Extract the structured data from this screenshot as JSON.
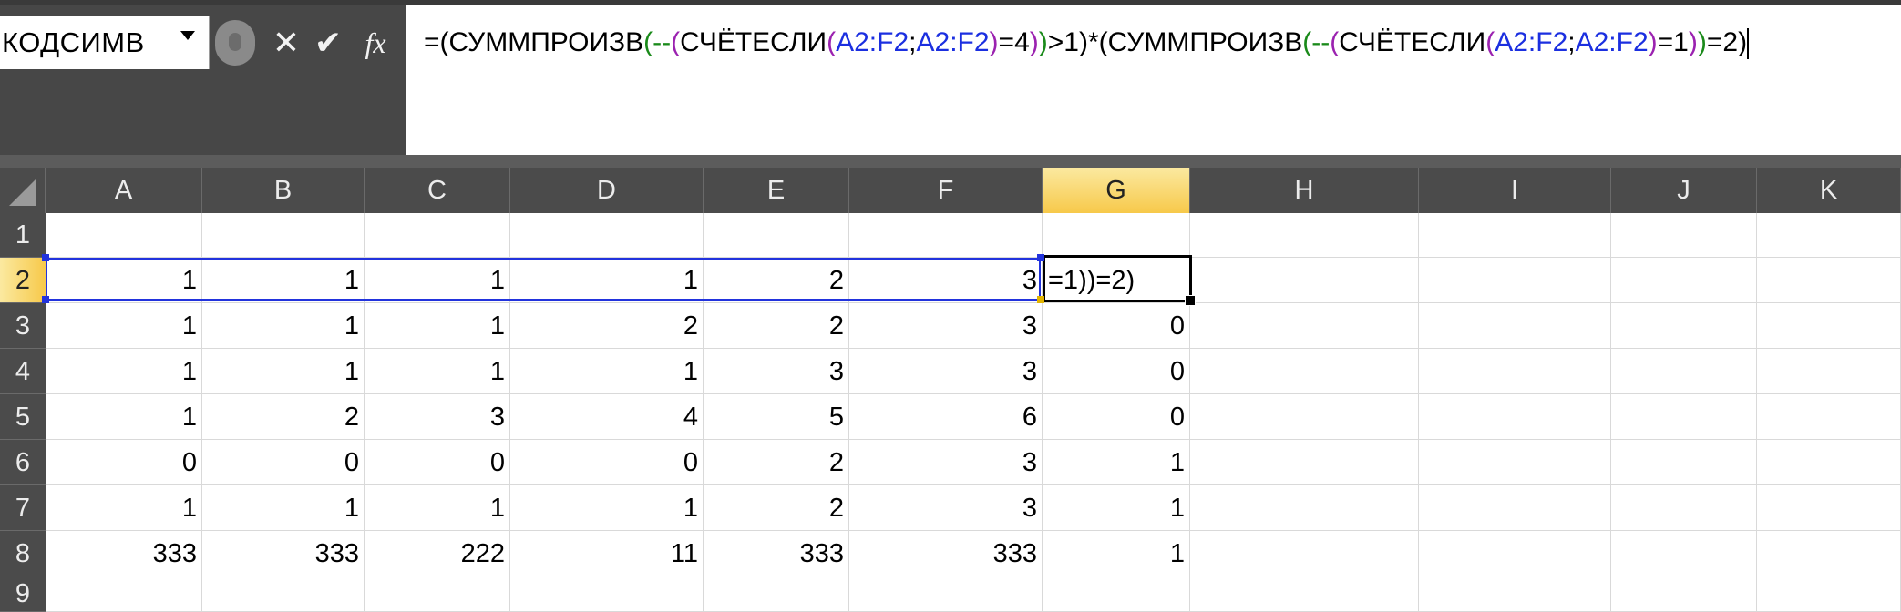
{
  "name_box": {
    "value": "КОДСИМВ"
  },
  "formula_bar": {
    "segments": [
      {
        "text": "=(СУММПРОИЗВ",
        "color": "#000000"
      },
      {
        "text": "(",
        "color": "#1a8a1a"
      },
      {
        "text": "--",
        "color": "#1a8a1a"
      },
      {
        "text": "(",
        "color": "#9b22b0"
      },
      {
        "text": "СЧЁТЕСЛИ",
        "color": "#000000"
      },
      {
        "text": "(",
        "color": "#9b22b0"
      },
      {
        "text": "A2:F2",
        "color": "#1b2fe0"
      },
      {
        "text": ";",
        "color": "#000000"
      },
      {
        "text": "A2:F2",
        "color": "#1b2fe0"
      },
      {
        "text": ")",
        "color": "#9b22b0"
      },
      {
        "text": "=4",
        "color": "#000000"
      },
      {
        "text": ")",
        "color": "#9b22b0"
      },
      {
        "text": ")",
        "color": "#1a8a1a"
      },
      {
        "text": ">1)*(СУММПРОИЗВ",
        "color": "#000000"
      },
      {
        "text": "(",
        "color": "#1a8a1a"
      },
      {
        "text": "--",
        "color": "#1a8a1a"
      },
      {
        "text": "(",
        "color": "#9b22b0"
      },
      {
        "text": "СЧЁТЕСЛИ",
        "color": "#000000"
      },
      {
        "text": "(",
        "color": "#9b22b0"
      },
      {
        "text": "A2:F2",
        "color": "#1b2fe0"
      },
      {
        "text": ";",
        "color": "#000000"
      },
      {
        "text": "A2:F2",
        "color": "#1b2fe0"
      },
      {
        "text": ")",
        "color": "#9b22b0"
      },
      {
        "text": "=1",
        "color": "#000000"
      },
      {
        "text": ")",
        "color": "#9b22b0"
      },
      {
        "text": ")",
        "color": "#1a8a1a"
      },
      {
        "text": "=2)",
        "color": "#000000"
      }
    ],
    "buttons": {
      "cancel_icon": "close-icon",
      "enter_icon": "check-icon",
      "fx_label": "fx"
    }
  },
  "grid": {
    "columns": [
      "A",
      "B",
      "C",
      "D",
      "E",
      "F",
      "G",
      "H",
      "I",
      "J",
      "K"
    ],
    "selected_column": "G",
    "rows": [
      "1",
      "2",
      "3",
      "4",
      "5",
      "6",
      "7",
      "8",
      "9"
    ],
    "selected_row": "2",
    "data": [
      [
        "",
        "",
        "",
        "",
        "",
        "",
        ""
      ],
      [
        "1",
        "1",
        "1",
        "1",
        "2",
        "3",
        ""
      ],
      [
        "1",
        "1",
        "1",
        "2",
        "2",
        "3",
        "0"
      ],
      [
        "1",
        "1",
        "1",
        "1",
        "3",
        "3",
        "0"
      ],
      [
        "1",
        "2",
        "3",
        "4",
        "5",
        "6",
        "0"
      ],
      [
        "0",
        "0",
        "0",
        "0",
        "2",
        "3",
        "1"
      ],
      [
        "1",
        "1",
        "1",
        "1",
        "2",
        "3",
        "1"
      ],
      [
        "333",
        "333",
        "222",
        "11",
        "333",
        "333",
        "1"
      ],
      [
        "",
        "",
        "",
        "",
        "",
        "",
        ""
      ]
    ],
    "active_cell_text": "=1))=2)",
    "highlight_colors": {
      "range": "#2233dd",
      "active": "#000000",
      "header_selected": "#f7c94a"
    }
  }
}
